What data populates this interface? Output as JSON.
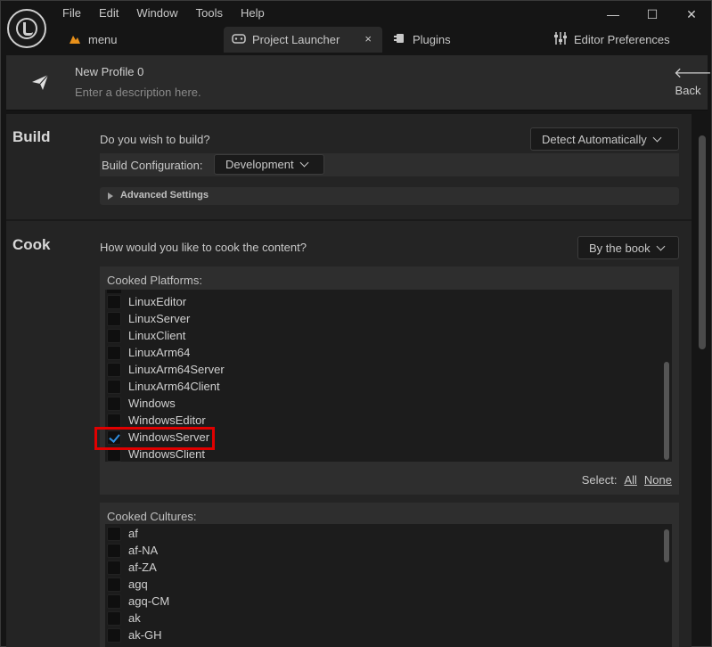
{
  "menu": [
    "File",
    "Edit",
    "Window",
    "Tools",
    "Help"
  ],
  "window_controls": {
    "minimize": "—",
    "maximize": "☐",
    "close": "✕"
  },
  "tabs": [
    {
      "label": "menu",
      "icon": "level-icon"
    },
    {
      "label": "Project Launcher",
      "icon": "launcher-icon",
      "close": "×"
    },
    {
      "label": "Plugins",
      "icon": "plugin-icon"
    },
    {
      "label": "Editor Preferences",
      "icon": "sliders-icon"
    }
  ],
  "profile": {
    "name": "New Profile 0",
    "description_placeholder": "Enter a description here.",
    "back_label": "Back"
  },
  "build": {
    "title": "Build",
    "question": "Do you wish to build?",
    "build_mode": "Detect Automatically",
    "config_label": "Build Configuration:",
    "config_value": "Development",
    "advanced_label": "Advanced Settings"
  },
  "cook": {
    "title": "Cook",
    "question": "How would you like to cook the content?",
    "cook_mode": "By the book",
    "platforms_title": "Cooked Platforms:",
    "platforms": [
      {
        "label": "LinuxEditor",
        "checked": false
      },
      {
        "label": "LinuxServer",
        "checked": false
      },
      {
        "label": "LinuxClient",
        "checked": false
      },
      {
        "label": "LinuxArm64",
        "checked": false
      },
      {
        "label": "LinuxArm64Server",
        "checked": false
      },
      {
        "label": "LinuxArm64Client",
        "checked": false
      },
      {
        "label": "Windows",
        "checked": false
      },
      {
        "label": "WindowsEditor",
        "checked": false
      },
      {
        "label": "WindowsServer",
        "checked": true
      },
      {
        "label": "WindowsClient",
        "checked": false
      }
    ],
    "select_label": "Select:",
    "select_all": "All",
    "select_none": "None",
    "cultures_title": "Cooked Cultures:",
    "cultures": [
      "af",
      "af-NA",
      "af-ZA",
      "agq",
      "agq-CM",
      "ak",
      "ak-GH"
    ]
  },
  "colors": {
    "accent": "#2f8fe0",
    "highlight": "#e00000",
    "background": "#242424"
  }
}
